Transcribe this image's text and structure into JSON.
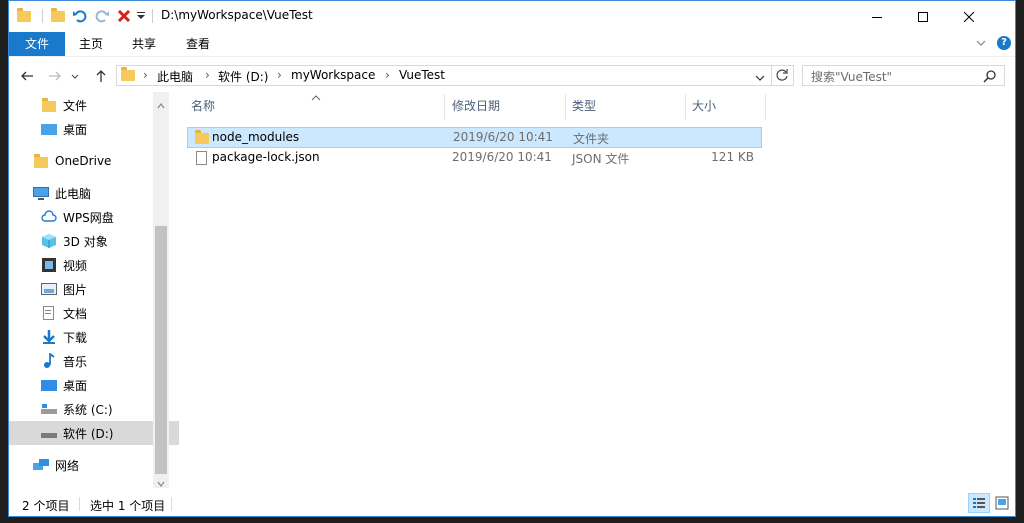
{
  "window": {
    "title": "D:\\myWorkspace\\VueTest"
  },
  "ribbon": {
    "tabs": [
      {
        "label": "文件"
      },
      {
        "label": "主页"
      },
      {
        "label": "共享"
      },
      {
        "label": "查看"
      }
    ]
  },
  "address": {
    "crumbs": [
      "此电脑",
      "软件 (D:)",
      "myWorkspace",
      "VueTest"
    ]
  },
  "search": {
    "placeholder": "搜索\"VueTest\""
  },
  "nav": {
    "items": [
      {
        "label": "文件"
      },
      {
        "label": "桌面"
      },
      {
        "label": "OneDrive"
      },
      {
        "label": "此电脑"
      },
      {
        "label": "WPS网盘"
      },
      {
        "label": "3D 对象"
      },
      {
        "label": "视频"
      },
      {
        "label": "图片"
      },
      {
        "label": "文档"
      },
      {
        "label": "下载"
      },
      {
        "label": "音乐"
      },
      {
        "label": "桌面"
      },
      {
        "label": "系统 (C:)"
      },
      {
        "label": "软件 (D:)"
      },
      {
        "label": "网络"
      }
    ]
  },
  "columns": {
    "name": "名称",
    "date": "修改日期",
    "type": "类型",
    "size": "大小"
  },
  "files": [
    {
      "name": "node_modules",
      "date": "2019/6/20 10:41",
      "type": "文件夹",
      "size": ""
    },
    {
      "name": "package-lock.json",
      "date": "2019/6/20 10:41",
      "type": "JSON 文件",
      "size": "121 KB"
    }
  ],
  "status": {
    "count": "2 个项目",
    "selected": "选中 1 个项目"
  },
  "colors": {
    "accent": "#1979ca",
    "selection": "#cce8ff",
    "folder": "#f6c95b"
  }
}
